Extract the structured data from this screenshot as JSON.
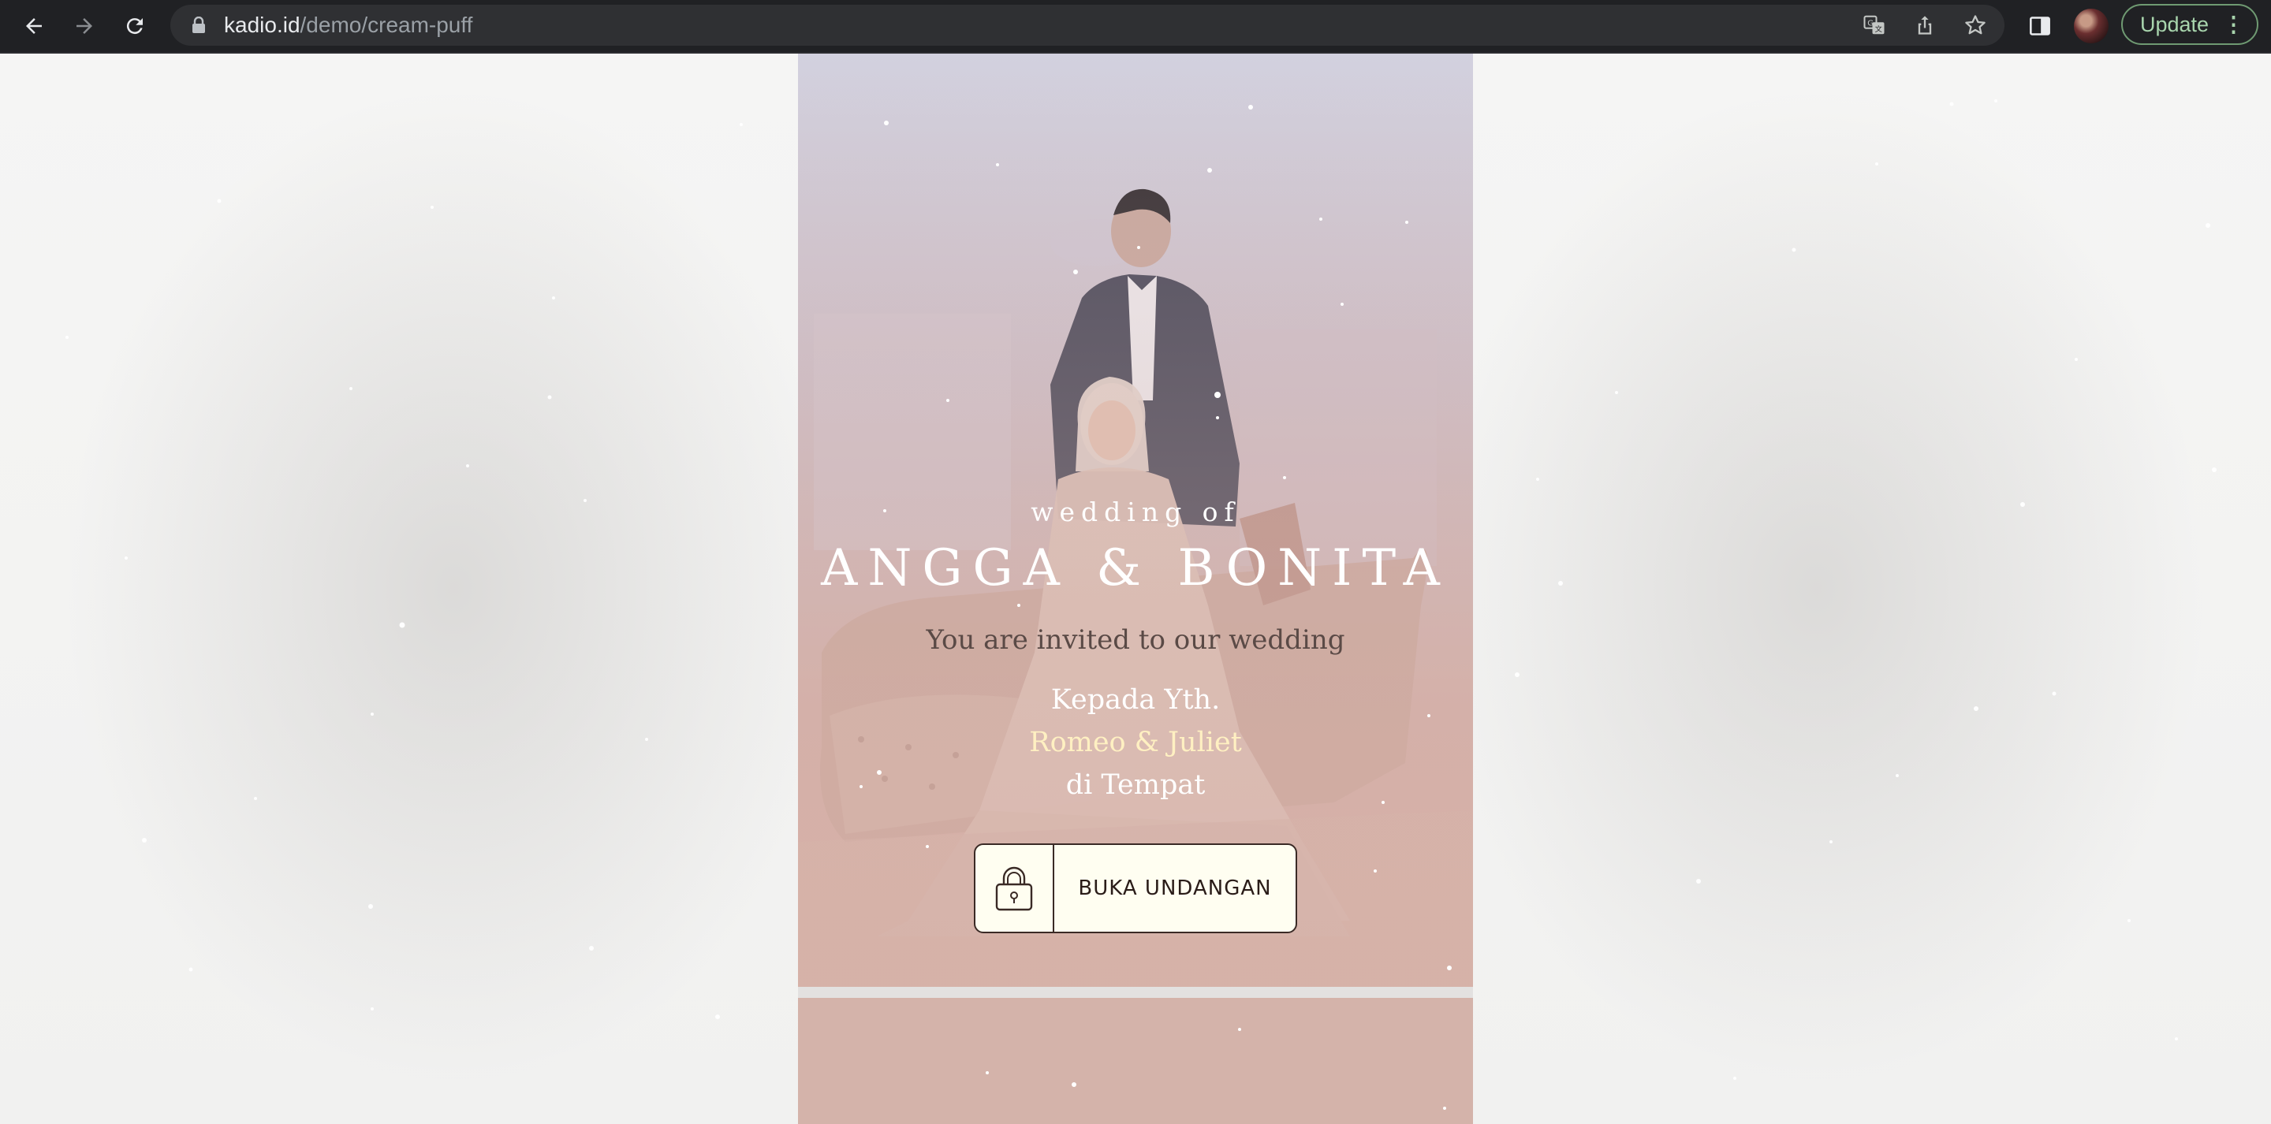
{
  "browser": {
    "url_host": "kadio.id",
    "url_path": "/demo/cream-puff",
    "update_label": "Update",
    "menu_glyph": "⋮",
    "icons": [
      "back-arrow-icon",
      "forward-arrow-icon",
      "reload-icon",
      "lock-icon",
      "translate-icon",
      "share-icon",
      "bookmark-star-icon",
      "side-panel-icon",
      "profile-avatar"
    ]
  },
  "invitation": {
    "pre_title": "wedding of",
    "couple_names": "ANGGA & BONITA",
    "invited_text": "You are invited to our wedding",
    "salutation": "Kepada Yth.",
    "guest_name": "Romeo & Juliet",
    "location_line": "di Tempat",
    "open_button_label": "BUKA UNDANGAN",
    "open_button_icon": "padlock-icon"
  },
  "colors": {
    "guest_name": "#fff0c2",
    "button_bg": "#fffef1",
    "cover_bottom": "#d7b1a7",
    "update_green": "#a8d5ad"
  }
}
